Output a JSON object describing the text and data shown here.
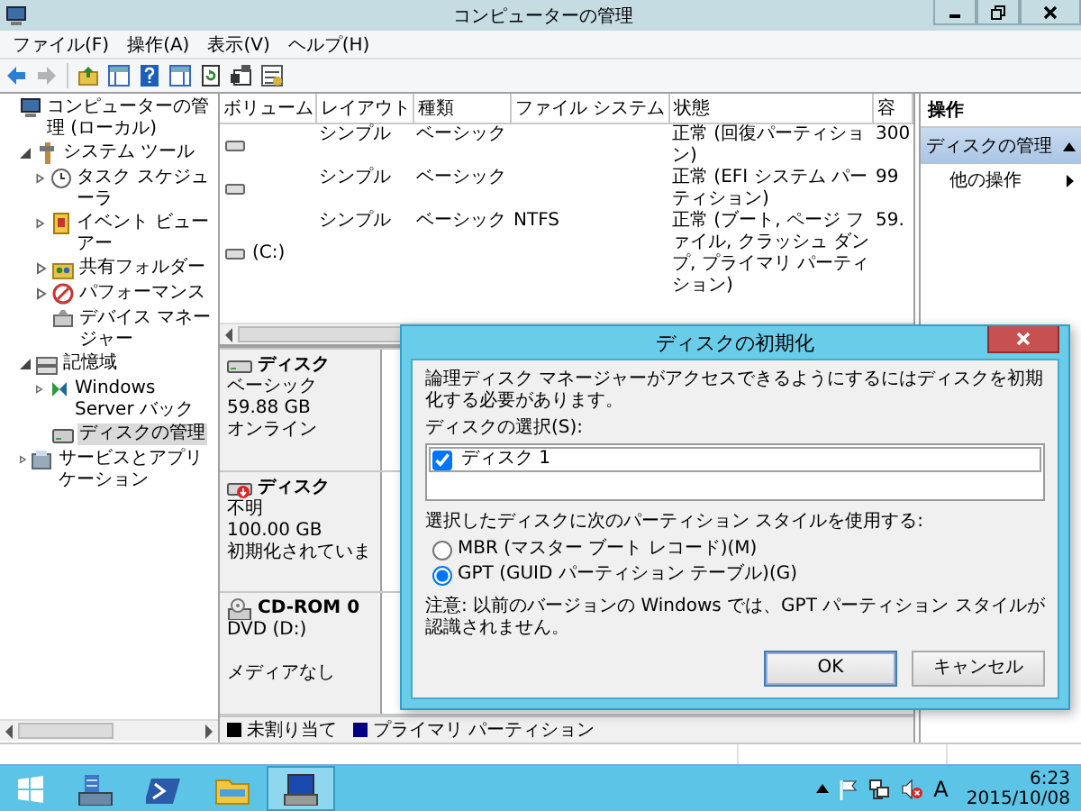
{
  "window": {
    "title": "コンピューターの管理"
  },
  "menu": [
    "ファイル(F)",
    "操作(A)",
    "表示(V)",
    "ヘルプ(H)"
  ],
  "navigation": {
    "back_disabled": false,
    "forward_disabled": true
  },
  "tree": [
    {
      "label": "コンピューターの管理 (ローカル)",
      "selected": false,
      "children": [
        {
          "label": "システム ツール",
          "expanded": true,
          "selected": false,
          "children": [
            {
              "label": "タスク スケジューラ",
              "expanded": false,
              "selected": false
            },
            {
              "label": "イベント ビューアー",
              "expanded": false,
              "selected": false
            },
            {
              "label": "共有フォルダー",
              "expanded": false,
              "selected": false
            },
            {
              "label": "パフォーマンス",
              "expanded": false,
              "selected": false
            },
            {
              "label": "デバイス マネージャー",
              "selected": false
            }
          ]
        },
        {
          "label": "記憶域",
          "expanded": true,
          "selected": false,
          "children": [
            {
              "label": "Windows Server バック",
              "expanded": false,
              "selected": false
            },
            {
              "label": "ディスクの管理",
              "selected": true
            }
          ]
        },
        {
          "label": "サービスとアプリケーション",
          "expanded": false,
          "selected": false
        }
      ]
    }
  ],
  "volumes": {
    "columns": [
      "ボリューム",
      "レイアウト",
      "種類",
      "ファイル システム",
      "状態",
      "容"
    ],
    "rows": [
      {
        "layout": "シンプル",
        "type": "ベーシック",
        "status": "正常 (回復パーティション)",
        "capacity": "300"
      },
      {
        "layout": "シンプル",
        "type": "ベーシック",
        "status": "正常 (EFI システム パーティション)",
        "capacity": "99"
      },
      {
        "volume": "(C:)",
        "layout": "シンプル",
        "type": "ベーシック",
        "file_system": "NTFS",
        "status": "正常 (ブート, ページ ファイル, クラッシュ ダンプ, プライマリ パーティション)",
        "capacity": "59."
      }
    ]
  },
  "disks": [
    {
      "kind": "disk",
      "name": "ディスク",
      "type": "ベーシック",
      "size": "59.88 GB",
      "status": "オンライン"
    },
    {
      "kind": "unknown",
      "name": "ディスク",
      "type": "不明",
      "size": "100.00 GB",
      "status": "初期化されていま"
    },
    {
      "kind": "cdrom",
      "name": "CD-ROM 0",
      "type": "DVD (D:)",
      "status": "メディアなし"
    }
  ],
  "legend": [
    {
      "label": "未割り当て",
      "color": "#000000"
    },
    {
      "label": "プライマリ パーティション",
      "color": "#000080"
    }
  ],
  "actions": {
    "header": "操作",
    "section": "ディスクの管理",
    "items": [
      "他の操作"
    ]
  },
  "dialog": {
    "title": "ディスクの初期化",
    "message": "論理ディスク マネージャーがアクセスできるようにするにはディスクを初期化する必要があります。",
    "disk_label": "ディスクの選択(S):",
    "disks": [
      {
        "label": "ディスク 1",
        "checked": true
      }
    ],
    "style_label": "選択したディスクに次のパーティション スタイルを使用する:",
    "styles": [
      {
        "label": "MBR (マスター ブート レコード)(M)",
        "selected": false
      },
      {
        "label": "GPT (GUID パーティション テーブル)(G)",
        "selected": true
      }
    ],
    "note": "注意: 以前のバージョンの Windows では、GPT パーティション スタイルが認識されません。",
    "buttons": [
      {
        "label": "OK",
        "default": true
      },
      {
        "label": "キャンセル",
        "default": false
      }
    ]
  },
  "taskbar": {
    "apps": [
      {
        "kind": "server-manager",
        "active": false
      },
      {
        "kind": "powershell",
        "active": false
      },
      {
        "kind": "explorer",
        "active": false
      },
      {
        "kind": "computer-management",
        "active": true
      }
    ],
    "ime": "A",
    "time": "6:23",
    "date": "2015/10/08"
  }
}
